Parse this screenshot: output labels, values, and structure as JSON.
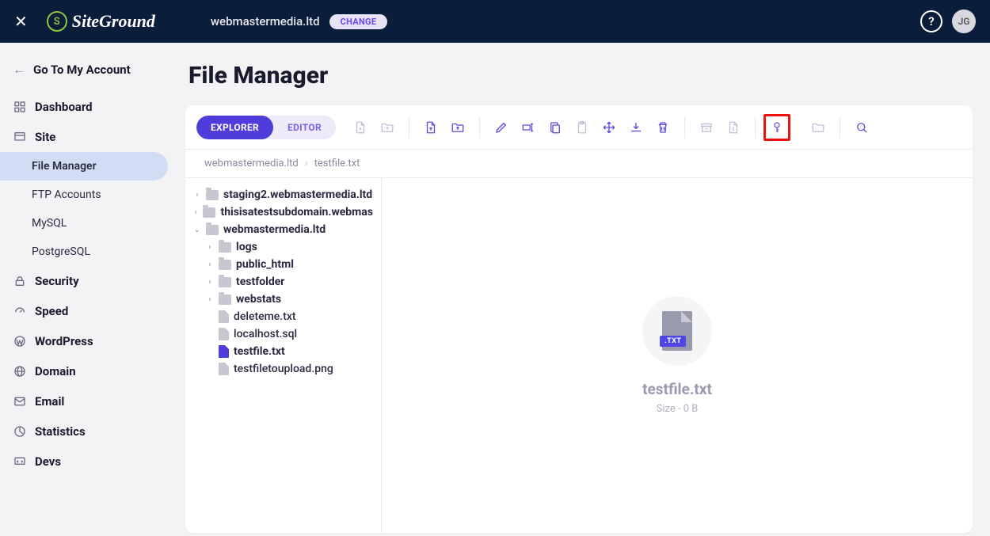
{
  "topbar": {
    "logo_text": "SiteGround",
    "domain": "webmastermedia.ltd",
    "change_label": "CHANGE",
    "avatar_initials": "JG"
  },
  "sidebar": {
    "go_back": "Go To My Account",
    "sections": [
      {
        "label": "Dashboard",
        "icon": "grid"
      },
      {
        "label": "Site",
        "icon": "site",
        "children": [
          {
            "label": "File Manager",
            "active": true
          },
          {
            "label": "FTP Accounts"
          },
          {
            "label": "MySQL"
          },
          {
            "label": "PostgreSQL"
          }
        ]
      },
      {
        "label": "Security",
        "icon": "lock"
      },
      {
        "label": "Speed",
        "icon": "speed"
      },
      {
        "label": "WordPress",
        "icon": "wordpress"
      },
      {
        "label": "Domain",
        "icon": "globe"
      },
      {
        "label": "Email",
        "icon": "mail"
      },
      {
        "label": "Statistics",
        "icon": "stats"
      },
      {
        "label": "Devs",
        "icon": "devs"
      }
    ]
  },
  "page": {
    "title": "File Manager"
  },
  "toolbar": {
    "explorer": "EXPLORER",
    "editor": "EDITOR"
  },
  "breadcrumb": [
    "webmastermedia.ltd",
    "testfile.txt"
  ],
  "tree": [
    {
      "type": "folder",
      "label": "staging2.webmastermedia.ltd",
      "depth": 0,
      "expanded": false
    },
    {
      "type": "folder",
      "label": "thisisatestsubdomain.webmas",
      "depth": 0,
      "expanded": false
    },
    {
      "type": "folder",
      "label": "webmastermedia.ltd",
      "depth": 0,
      "expanded": true
    },
    {
      "type": "folder",
      "label": "logs",
      "depth": 1,
      "expanded": false
    },
    {
      "type": "folder",
      "label": "public_html",
      "depth": 1,
      "expanded": false
    },
    {
      "type": "folder",
      "label": "testfolder",
      "depth": 1,
      "expanded": false
    },
    {
      "type": "folder",
      "label": "webstats",
      "depth": 1,
      "expanded": false
    },
    {
      "type": "file",
      "label": "deleteme.txt",
      "depth": 1
    },
    {
      "type": "file",
      "label": "localhost.sql",
      "depth": 1
    },
    {
      "type": "file",
      "label": "testfile.txt",
      "depth": 1,
      "selected": true
    },
    {
      "type": "file",
      "label": "testfiletoupload.png",
      "depth": 1
    }
  ],
  "preview": {
    "ext": ".TXT",
    "name": "testfile.txt",
    "size": "Size - 0 B"
  }
}
